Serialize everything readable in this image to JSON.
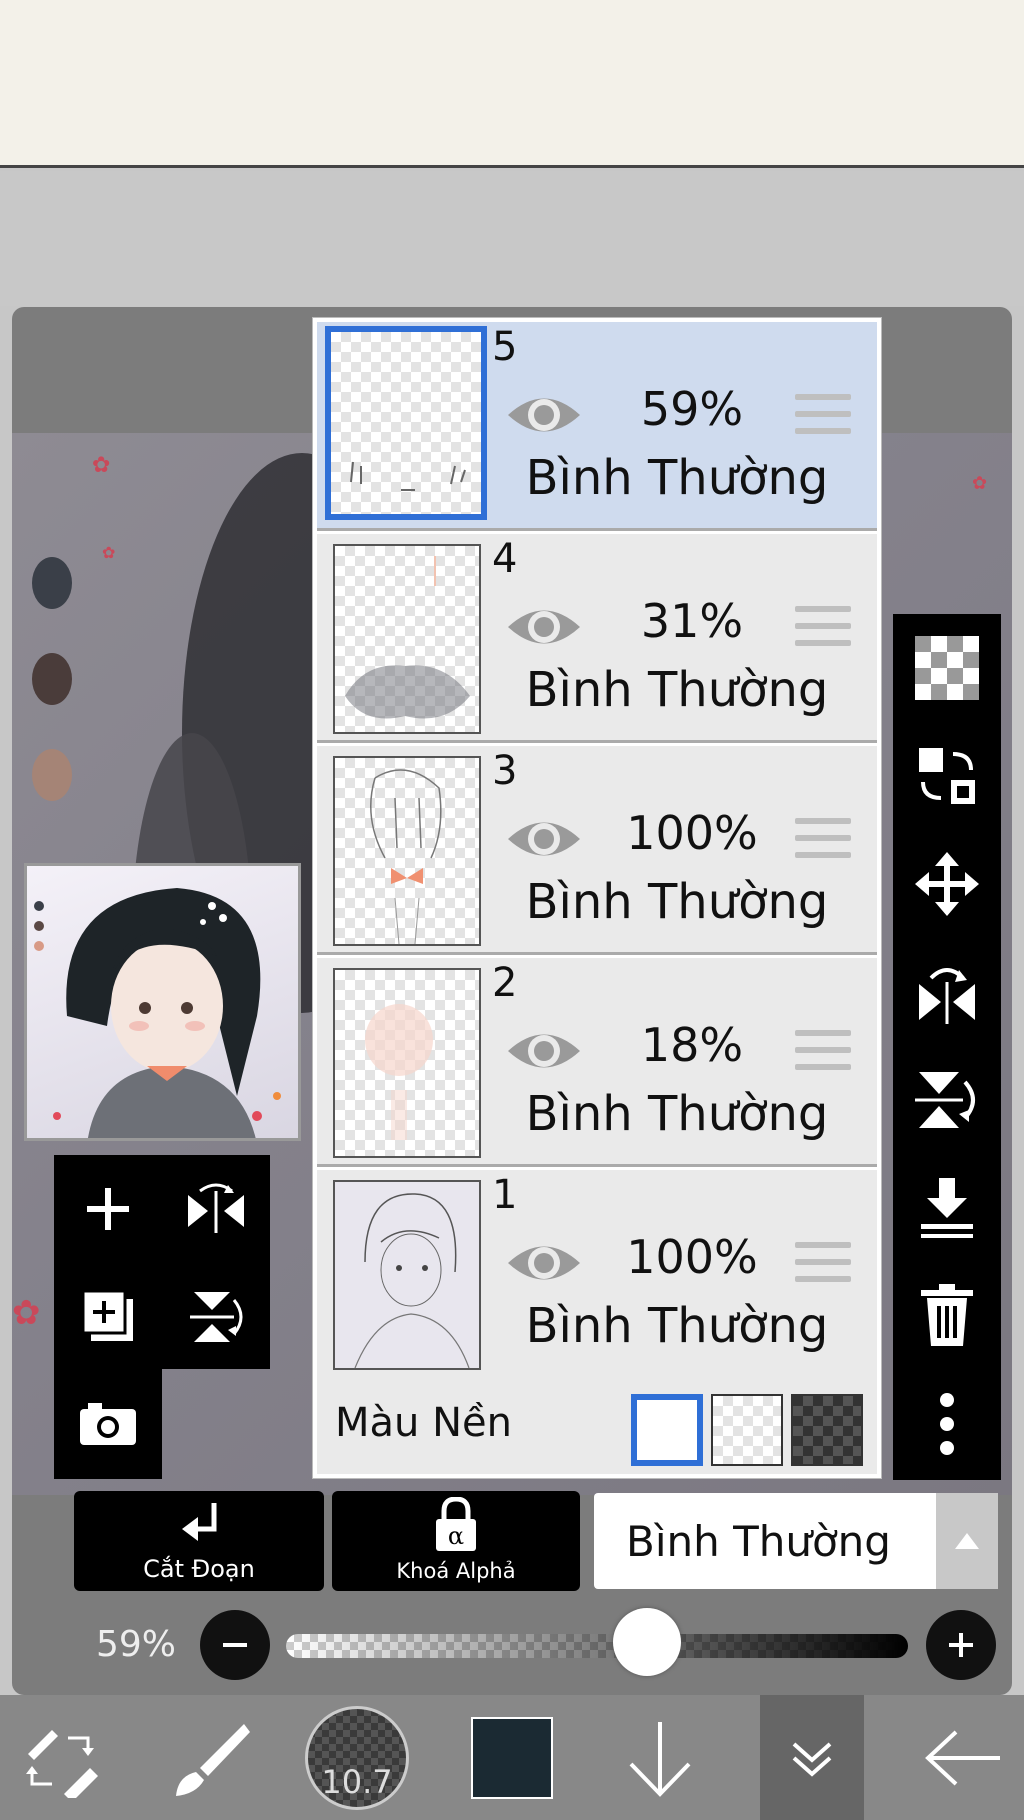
{
  "layers": [
    {
      "number": "5",
      "opacity": "59%",
      "blend": "Bình Thường",
      "selected": true
    },
    {
      "number": "4",
      "opacity": "31%",
      "blend": "Bình Thường",
      "selected": false
    },
    {
      "number": "3",
      "opacity": "100%",
      "blend": "Bình Thường",
      "selected": false
    },
    {
      "number": "2",
      "opacity": "18%",
      "blend": "Bình Thường",
      "selected": false
    },
    {
      "number": "1",
      "opacity": "100%",
      "blend": "Bình Thường",
      "selected": false
    }
  ],
  "background": {
    "label": "Màu Nền",
    "selected_index": 0
  },
  "buttons": {
    "clipping_label": "Cắt Đoạn",
    "alpha_lock_label": "Khoá Alphả"
  },
  "blend_mode": {
    "value": "Bình Thường"
  },
  "opacity": {
    "label": "59%",
    "value": 0.59
  },
  "brush": {
    "size": "10.7"
  },
  "colors": {
    "accent": "#2f6fd6",
    "selected_layer": "#cfdbee",
    "current_color": "#1b2a33"
  },
  "icons": [
    "swap-tool-icon",
    "brush-icon",
    "brush-size-icon",
    "color-swatch-icon",
    "arrow-down-icon",
    "double-chevron-icon",
    "back-arrow-icon",
    "add-layer-icon",
    "flip-horizontal-icon",
    "copy-layer-icon",
    "flip-vertical-icon",
    "camera-icon",
    "transparency-icon",
    "layer-transfer-icon",
    "move-icon",
    "rotate-flip-icon",
    "merge-down-icon",
    "trash-icon",
    "more-icon"
  ]
}
